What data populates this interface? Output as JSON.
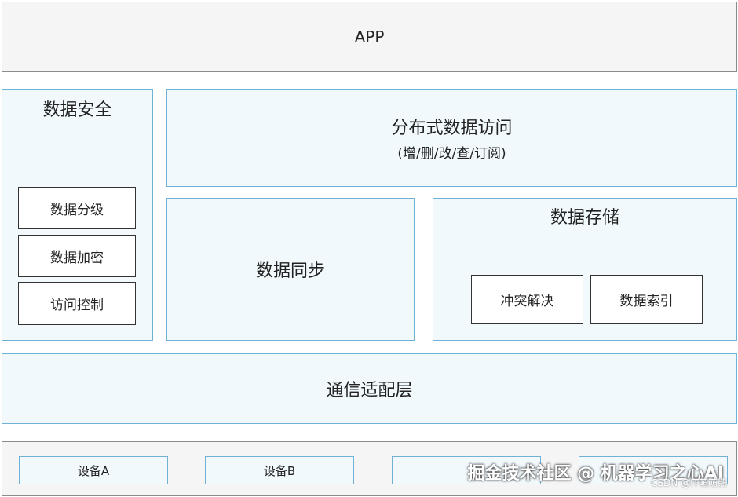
{
  "app": {
    "label": "APP"
  },
  "security": {
    "title": "数据安全",
    "items": [
      "数据分级",
      "数据加密",
      "访问控制"
    ]
  },
  "distributed_access": {
    "title": "分布式数据访问",
    "subtitle": "(增/删/改/查/订阅)"
  },
  "sync": {
    "label": "数据同步"
  },
  "storage": {
    "title": "数据存储",
    "items": [
      "冲突解决",
      "数据索引"
    ]
  },
  "comm_layer": {
    "label": "通信适配层"
  },
  "devices": {
    "items": [
      "设备A",
      "设备B",
      "",
      ""
    ]
  },
  "watermark": {
    "main": "掘金技术社区 @ 机器学习之心AI",
    "sub": "CSDN @IT萌萌熊"
  },
  "colors": {
    "layer_fill": "#f1f9fd",
    "layer_border": "#6fb2d6",
    "app_fill": "#f5f5f5",
    "app_border": "#8c8c8c"
  }
}
